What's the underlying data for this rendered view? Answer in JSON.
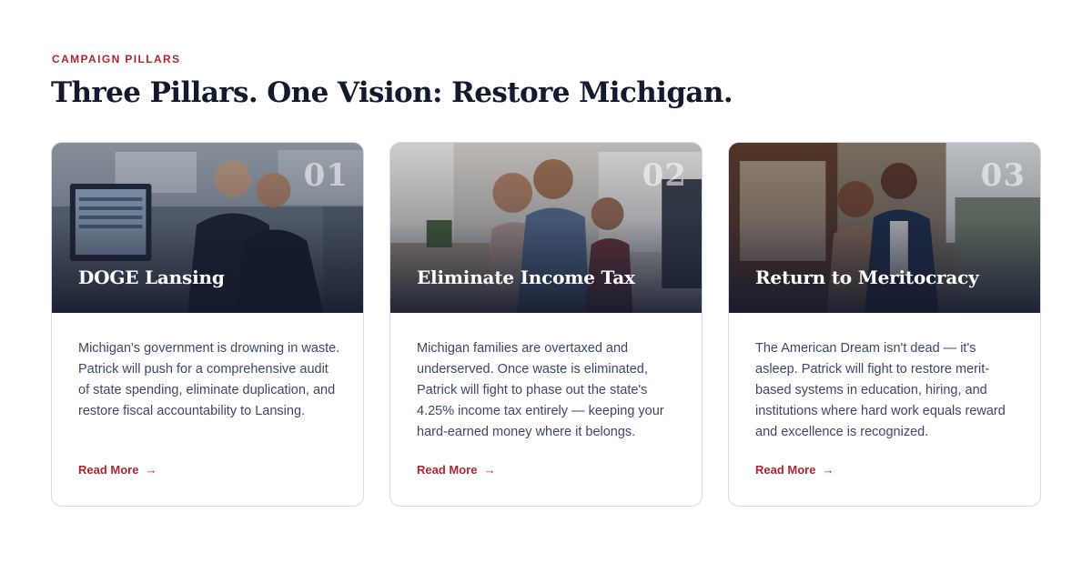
{
  "section": {
    "eyebrow": "CAMPAIGN PILLARS",
    "headline": "Three Pillars. One Vision: Restore Michigan."
  },
  "cards": [
    {
      "number": "01",
      "title": "DOGE Lansing",
      "body": "Michigan's government is drowning in waste. Patrick will push for a comprehensive audit of state spending, eliminate duplication, and restore fiscal accountability to Lansing.",
      "link": "Read More",
      "image": "office-team-reviewing-spending-dashboard"
    },
    {
      "number": "02",
      "title": "Eliminate Income Tax",
      "body": "Michigan families are overtaxed and underserved. Once waste is eliminated, Patrick will fight to phase out the state's 4.25% income tax entirely — keeping your hard-earned money where it belongs.",
      "link": "Read More",
      "image": "family-in-kitchen"
    },
    {
      "number": "03",
      "title": "Return to Meritocracy",
      "body": "The American Dream isn't dead — it's asleep. Patrick will fight to restore merit-based systems in education, hiring, and institutions where hard work equals reward and excellence is recognized.",
      "link": "Read More",
      "image": "couple-on-main-street"
    }
  ],
  "icons": {
    "read_more": "arrow-right-icon"
  },
  "colors": {
    "accent": "#b3242f",
    "heading": "#131a2e",
    "body": "#3c4866",
    "border": "#d4d8e8"
  }
}
